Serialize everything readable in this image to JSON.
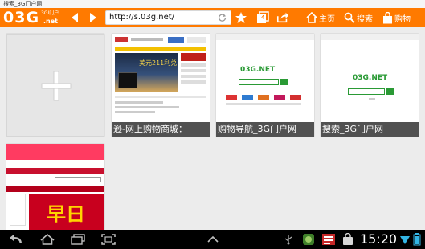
{
  "status": {
    "title": "搜索_3G门户网"
  },
  "toolbar": {
    "logo_text": "03G",
    "logo_sub1": "3GI门户",
    "logo_sub2": ".net",
    "url": "http://s.03g.net/",
    "tab_count": "4",
    "home_label": "主页",
    "search_label": "搜索",
    "shop_label": "购物"
  },
  "tiles": [
    {
      "label": ""
    },
    {
      "label": "逊-网上购物商城："
    },
    {
      "label": "购物导航_3G门户网"
    },
    {
      "label": "搜索_3G门户网"
    },
    {
      "label": ""
    }
  ],
  "thumb": {
    "site_logo": "03G.NET",
    "banner": "美元211利兑",
    "big_text": "早日"
  },
  "system": {
    "time": "15:20"
  },
  "colors": {
    "accent": "#ff7a00",
    "site_green": "#2a9a35"
  }
}
